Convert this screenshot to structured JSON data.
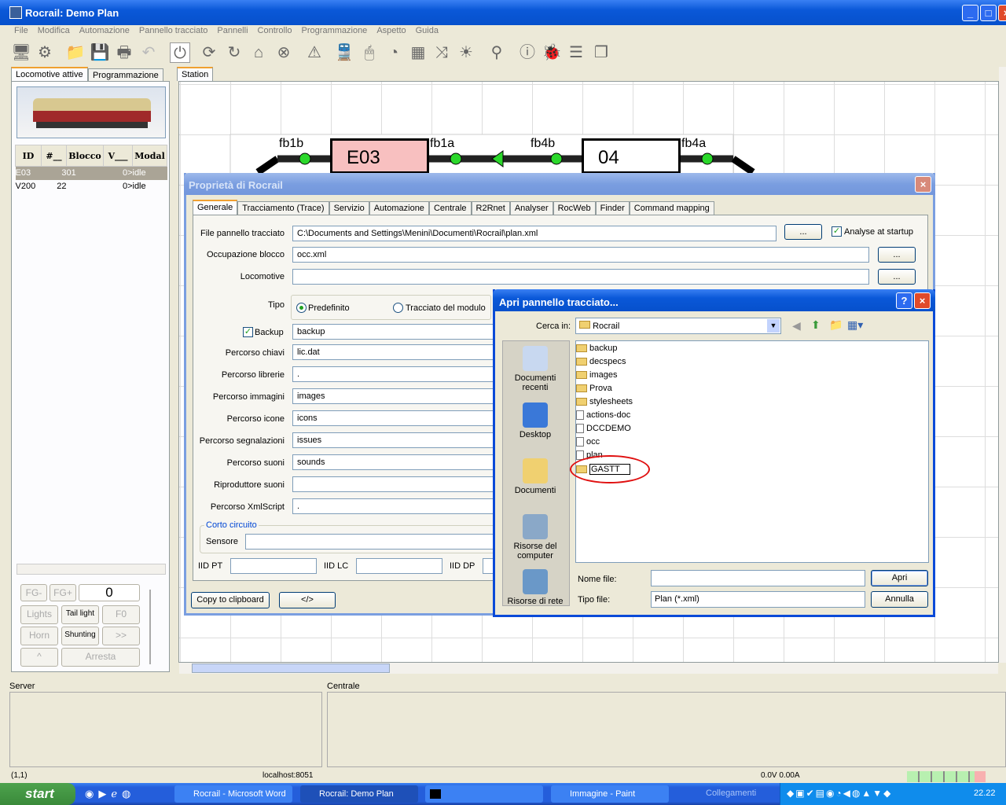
{
  "window": {
    "title": "Rocrail: Demo Plan"
  },
  "menu": [
    "File",
    "Modifica",
    "Automazione",
    "Pannello tracciato",
    "Pannelli",
    "Controllo",
    "Programmazione",
    "Aspetto",
    "Guida"
  ],
  "toolbar_icons": [
    "server-icon",
    "settings-icon",
    "open-icon",
    "save-icon",
    "print-icon",
    "undo-icon",
    "power-icon",
    "sync-icon",
    "reset-icon",
    "home-icon",
    "stop-icon",
    "warning-icon",
    "train-icon",
    "mouse-icon",
    "speedometer-icon",
    "grid-icon",
    "shuffle-icon",
    "light-icon",
    "search-icon",
    "info-icon",
    "bug-icon",
    "list-icon",
    "pages-icon"
  ],
  "left": {
    "tabs": [
      "Locomotive attive",
      "Programmazione"
    ],
    "table": {
      "headers": [
        "ID",
        "#__",
        "Blocco",
        "V___",
        "Modal"
      ],
      "rows": [
        [
          "E03",
          "3",
          "01",
          "0>",
          "idle"
        ],
        [
          "V200",
          "22",
          "",
          "0>",
          "idle"
        ]
      ]
    },
    "controls": {
      "fg_minus": "FG-",
      "fg_plus": "FG+",
      "speed": "0",
      "lights": "Lights",
      "tail_light": "Tail light",
      "f0": "F0",
      "horn": "Horn",
      "shunting": "Shunting",
      "forward": ">>",
      "up": "^",
      "stop": "Arresta"
    }
  },
  "plan": {
    "tab": "Station",
    "blocks": [
      {
        "id": "E03",
        "color": "#f8c0c0"
      },
      {
        "id": "04",
        "color": "#ffffff"
      }
    ],
    "sensors": [
      "fb1b",
      "fb1a",
      "fb4b",
      "fb4a"
    ]
  },
  "props": {
    "title": "Proprietà di Rocrail",
    "tabs": [
      "Generale",
      "Tracciamento (Trace)",
      "Servizio",
      "Automazione",
      "Centrale",
      "R2Rnet",
      "Analyser",
      "RocWeb",
      "Finder",
      "Command mapping"
    ],
    "fields": [
      {
        "label": "File pannello tracciato",
        "value": "C:\\Documents and Settings\\Menini\\Documenti\\Rocrail\\plan.xml"
      },
      {
        "label": "Occupazione blocco",
        "value": "occ.xml"
      },
      {
        "label": "Locomotive",
        "value": ""
      },
      {
        "label": "Percorso chiavi",
        "value": "lic.dat"
      },
      {
        "label": "Percorso librerie",
        "value": "."
      },
      {
        "label": "Percorso immagini",
        "value": "images"
      },
      {
        "label": "Percorso icone",
        "value": "icons"
      },
      {
        "label": "Percorso segnalazioni",
        "value": "issues"
      },
      {
        "label": "Percorso suoni",
        "value": "sounds"
      },
      {
        "label": "Riproduttore suoni",
        "value": ""
      },
      {
        "label": "Percorso XmlScript",
        "value": "."
      }
    ],
    "browse": "...",
    "analyse": "Analyse at startup",
    "tipo": "Tipo",
    "radio1": "Predefinito",
    "radio2": "Tracciato del modulo",
    "backup_label": "Backup",
    "backup_value": "backup",
    "corto": "Corto circuito",
    "sensore": "Sensore",
    "iid_pt": "IID PT",
    "iid_lc": "IID LC",
    "iid_dp": "IID DP",
    "copy": "Copy to clipboard",
    "xml": "</>"
  },
  "open": {
    "title": "Apri pannello tracciato...",
    "cerca": "Cerca in:",
    "folder": "Rocrail",
    "places": [
      "Documenti recenti",
      "Desktop",
      "Documenti",
      "Risorse del computer",
      "Risorse di rete"
    ],
    "files": [
      {
        "name": "backup",
        "type": "folder"
      },
      {
        "name": "decspecs",
        "type": "folder"
      },
      {
        "name": "images",
        "type": "folder"
      },
      {
        "name": "Prova",
        "type": "folder"
      },
      {
        "name": "stylesheets",
        "type": "folder"
      },
      {
        "name": "actions-doc",
        "type": "file"
      },
      {
        "name": "DCCDEMO",
        "type": "file"
      },
      {
        "name": "occ",
        "type": "file"
      },
      {
        "name": "plan",
        "type": "file"
      }
    ],
    "new_folder": "GASTT",
    "nome": "Nome file:",
    "tipo": "Tipo file:",
    "tipo_value": "Plan (*.xml)",
    "apri": "Apri",
    "annulla": "Annulla"
  },
  "panels": {
    "server": "Server",
    "centrale": "Centrale"
  },
  "status": {
    "pos": "(1,1)",
    "host": "localhost:8051",
    "power": "0.0V 0.00A"
  },
  "taskbar": {
    "start": "start",
    "tasks": [
      "Rocrail - Microsoft Word",
      "Rocrail: Demo Plan",
      "",
      "Immagine - Paint"
    ],
    "links": "Collegamenti",
    "time": "22.22"
  }
}
